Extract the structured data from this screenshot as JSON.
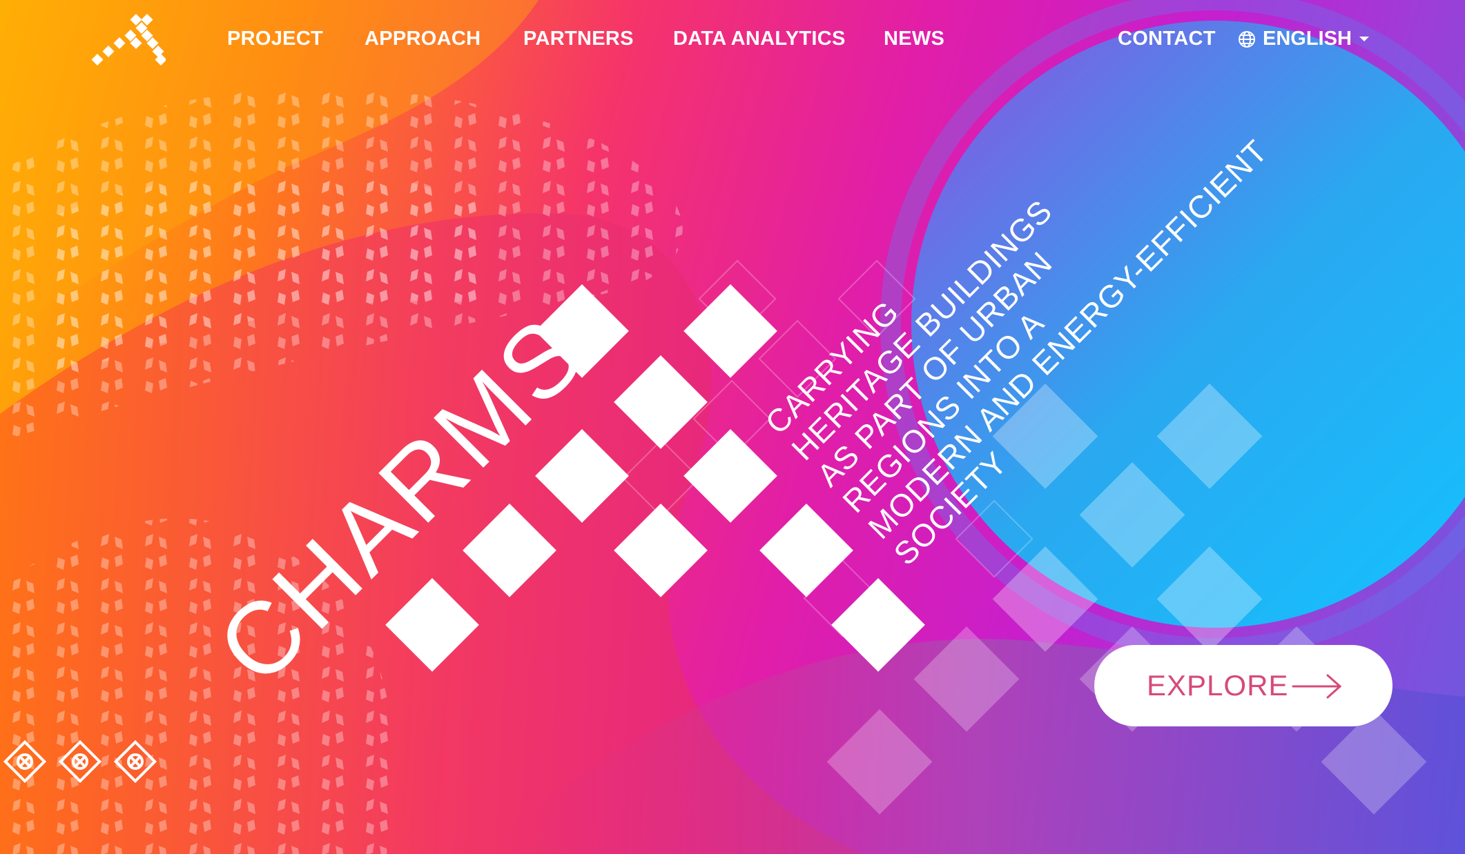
{
  "nav": {
    "items": [
      {
        "label": "PROJECT"
      },
      {
        "label": "APPROACH"
      },
      {
        "label": "PARTNERS"
      },
      {
        "label": "DATA ANALYTICS"
      },
      {
        "label": "NEWS"
      }
    ],
    "contact": "CONTACT",
    "language": "ENGLISH",
    "icons": [
      "logo-mark",
      "globe-icon",
      "caret-down-icon"
    ]
  },
  "hero": {
    "brand": "CHARMS",
    "tagline_lines": [
      "CARRYING",
      "HERITAGE BUILDINGS",
      "AS PART OF URBAN",
      "REGIONS INTO A",
      "MODERN AND ENERGY-EFFICIENT",
      "SOCIETY"
    ],
    "explore_label": "EXPLORE",
    "explore_icon": "arrow-right-icon"
  },
  "colors": {
    "explore_text": "#d64a78",
    "gradient_start": "#ffb800",
    "gradient_mid": "#e11ea8",
    "gradient_end": "#00b8f5"
  }
}
